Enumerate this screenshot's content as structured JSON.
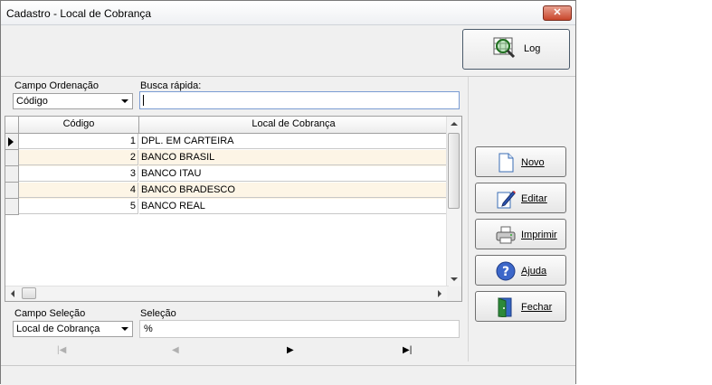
{
  "window": {
    "title": "Cadastro - Local de Cobrança",
    "close_glyph": "✕"
  },
  "toolbar": {
    "log_label": "Log",
    "log_icon": "magnifier-grid-icon"
  },
  "filters": {
    "sort_label": "Campo Ordenação",
    "sort_value": "Código",
    "quick_search_label": "Busca rápida:",
    "quick_search_value": ""
  },
  "table": {
    "columns": [
      "Código",
      "Local de Cobrança"
    ],
    "rows": [
      {
        "code": "1",
        "name": "DPL. EM CARTEIRA"
      },
      {
        "code": "2",
        "name": "BANCO BRASIL"
      },
      {
        "code": "3",
        "name": "BANCO ITAU"
      },
      {
        "code": "4",
        "name": "BANCO BRADESCO"
      },
      {
        "code": "5",
        "name": "BANCO REAL"
      }
    ],
    "alt_row_color": "#fdf5e6"
  },
  "selection": {
    "field_label": "Campo Seleção",
    "field_value": "Local de Cobrança",
    "selection_label": "Seleção",
    "selection_value": "%"
  },
  "navigator": {
    "first": "|◀",
    "prev": "◀",
    "next": "▶",
    "last": "▶|"
  },
  "actions": [
    {
      "label": "Novo",
      "icon": "new-document-icon"
    },
    {
      "label": "Editar",
      "icon": "edit-pen-icon"
    },
    {
      "label": "Imprimir",
      "icon": "printer-icon"
    },
    {
      "label": "Ajuda",
      "icon": "help-icon"
    },
    {
      "label": "Fechar",
      "icon": "exit-door-icon"
    }
  ]
}
